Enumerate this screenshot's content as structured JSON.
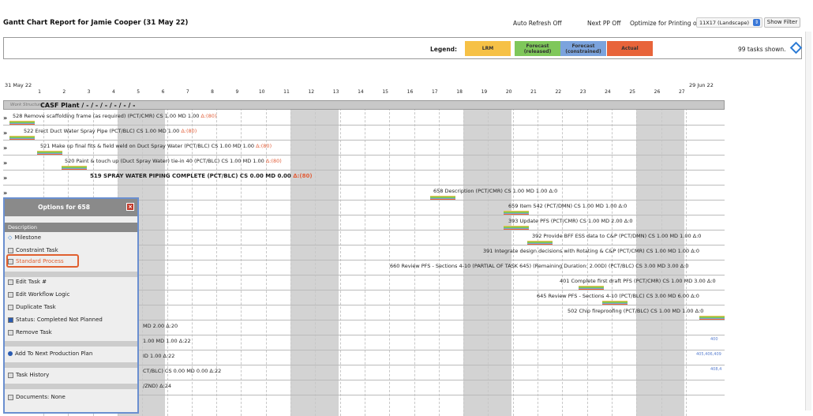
{
  "header": {
    "title": "Gantt Chart Report for Jamie Cooper (31 May 22)",
    "auto_refresh": "Auto Refresh Off",
    "next_pp": "Next PP Off",
    "optimize_label": "Optimize for Printing on:",
    "optimize_value": "11X17 (Landscape)",
    "show_filter": "Show Filter"
  },
  "legend": {
    "label": "Legend:",
    "items": [
      {
        "label": "LRM",
        "color": "#f6c146"
      },
      {
        "label": "Forecast\n(released)",
        "color": "#7fc75a"
      },
      {
        "label": "Forecast\n(constrained)",
        "color": "#7ba3dd"
      },
      {
        "label": "Actual",
        "color": "#e8643a"
      }
    ],
    "tasks_shown": "99 tasks shown."
  },
  "timeline": {
    "start_date": "31 May 22",
    "end_date": "29 Jun 22",
    "days": [
      "1",
      "2",
      "3",
      "4",
      "5",
      "6",
      "7",
      "8",
      "9",
      "10",
      "11",
      "12",
      "13",
      "14",
      "15",
      "16",
      "17",
      "18",
      "19",
      "20",
      "21",
      "22",
      "23",
      "24",
      "25",
      "26",
      "27"
    ]
  },
  "work_structure": {
    "prefix": "Work Structure -",
    "name": "CASF Plant / - / - / - / - / - / -"
  },
  "tasks": [
    {
      "text": "528 Remove scaffolding frame (as required) (PCT/CMR) CS 1.00 MD 1.00 ",
      "delta": "Δ:(80)",
      "arrow": "»"
    },
    {
      "text": "522 Erect Duct Water Spray Pipe (PCT/BLC) CS 1.00 MD 1.00 ",
      "delta": "Δ:(80)",
      "arrow": "»"
    },
    {
      "text": "521 Make up final fits & field weld on Duct Spray Water (PCT/BLC) CS 1.00 MD 1.00 ",
      "delta": "Δ:(80)",
      "arrow": "»"
    },
    {
      "text": "520 Paint & touch up (Duct Spray Water) tie-in 40 (PCT/BLC) CS 1.00 MD 1.00 ",
      "delta": "Δ:(80)",
      "arrow": "»"
    },
    {
      "text": "519 SPRAY WATER PIPING COMPLETE (PCT/BLC) CS 0.00 MD 0.00 ",
      "delta": "Δ:(80)",
      "arrow": "»"
    },
    {
      "text": "658 Description (PCT/CMR) CS 1.00 MD 1.00 Δ:0",
      "delta": "",
      "arrow": "»"
    },
    {
      "text": "659 Item 542 (PCT/DMN) CS 1.00 MD 1.00 Δ:0",
      "delta": "",
      "arrow": ""
    },
    {
      "text": "393 Update PFS (PCT/CMR) CS 1.00 MD 2.00 Δ:0",
      "delta": "",
      "arrow": ""
    },
    {
      "text": "392 Provide BFF ESS data to C&P (PCT/DMN) CS 1.00 MD 1.00 Δ:0",
      "delta": "",
      "arrow": ""
    },
    {
      "text": "391 Integrate design decisions with Rotating & C&P (PCT/CMR) CS 1.00 MD 1.00 Δ:0",
      "delta": "",
      "arrow": ""
    },
    {
      "text": "660 Review PFS - Sections 4-10 (PARTIAL OF TASK 645) (Remaining Duration: 2.00D) (PCT/BLC) CS 3.00 MD 3.00 Δ:0",
      "delta": "",
      "arrow": ""
    },
    {
      "text": "401 Complete first draft PFS (PCT/CMR) CS 1.00 MD 3.00 Δ:0",
      "delta": "",
      "arrow": ""
    },
    {
      "text": "645 Review PFS - Sections 4-10 (PCT/BLC) CS 3.00 MD 6.00 Δ:0",
      "delta": "",
      "arrow": ""
    },
    {
      "text": "502 Chip fireproofing (PCT/BLC) CS 1.00 MD 1.00 Δ:0",
      "delta": "",
      "arrow": ""
    },
    {
      "text": "MD 2.00 Δ:20",
      "delta": "",
      "arrow": ""
    },
    {
      "text": "1.00 MD 1.00 Δ:22",
      "delta": "",
      "arrow": ""
    },
    {
      "text": "ID 1.00 Δ:22",
      "delta": "",
      "arrow": ""
    },
    {
      "text": "CT/BLC) CS 0.00 MD 0.00 Δ:22",
      "delta": "",
      "arrow": ""
    },
    {
      "text": "/ZND) Δ:24",
      "delta": "",
      "arrow": ""
    }
  ],
  "right_edge_labels": [
    "400",
    "405,406,409",
    "408,4"
  ],
  "options_panel": {
    "title": "Options for 658",
    "close": "×",
    "description_header": "Description",
    "items": [
      {
        "label": "Milestone"
      },
      {
        "label": "Constraint Task"
      },
      {
        "label": "Standard Process"
      },
      {
        "label": "Edit Task #"
      },
      {
        "label": "Edit Workflow Logic"
      },
      {
        "label": "Duplicate Task"
      },
      {
        "label": "Status: Completed Not Planned"
      },
      {
        "label": "Remove Task"
      },
      {
        "label": "Add To Next Production Plan"
      },
      {
        "label": "Task History"
      },
      {
        "label": "Documents: None"
      }
    ]
  }
}
